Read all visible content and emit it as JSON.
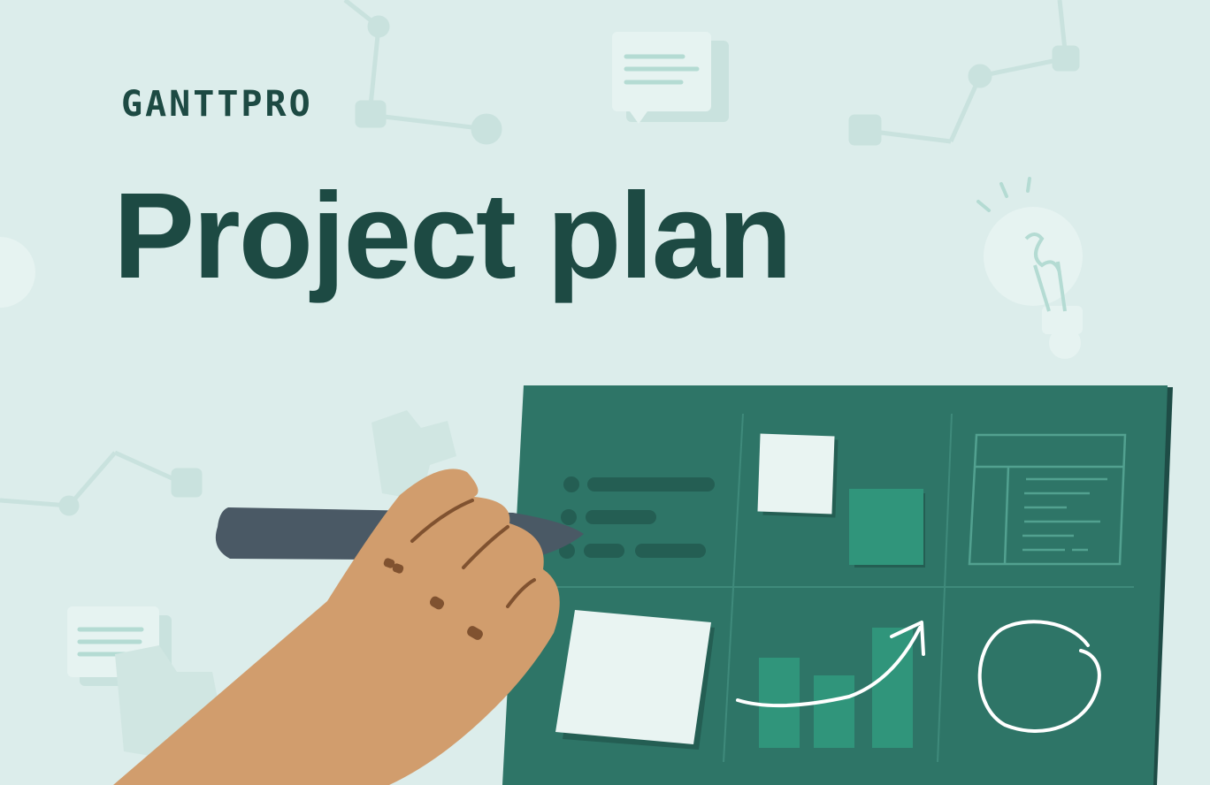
{
  "brand": {
    "logo_text": "GANTTPRO"
  },
  "hero": {
    "title": "Project plan"
  },
  "colors": {
    "background": "#dcedeb",
    "text": "#1d4a43",
    "board": "#2e7567",
    "board_accent": "#30957b",
    "hand": "#d19d6d",
    "pen": "#4a5965"
  },
  "illustration": {
    "icons": [
      "chat-bubble-icon",
      "lightbulb-icon",
      "puzzle-icon",
      "network-icon",
      "trend-arrow-icon"
    ],
    "board_panels": [
      "list-panel",
      "sticky-notes-panel",
      "document-panel",
      "note-panel",
      "bar-chart-panel",
      "circle-sketch-panel"
    ]
  }
}
